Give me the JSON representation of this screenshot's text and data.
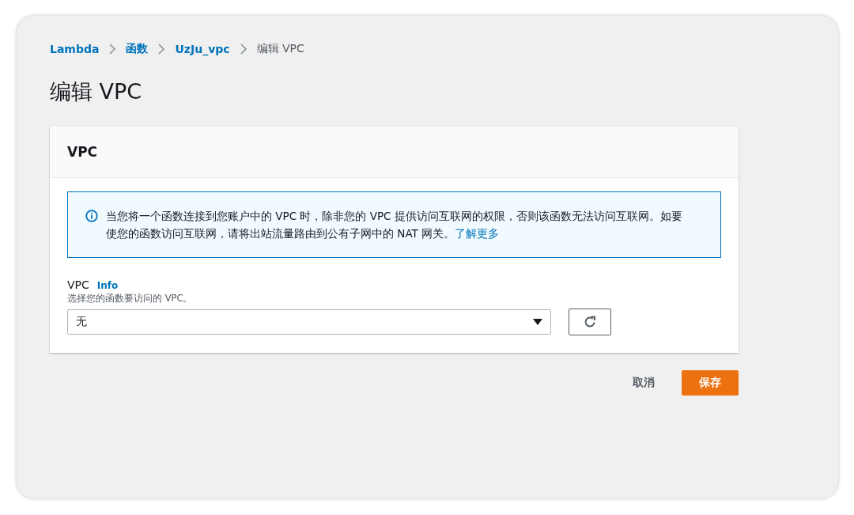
{
  "breadcrumb": [
    {
      "label": "Lambda",
      "link": true
    },
    {
      "label": "函数",
      "link": true
    },
    {
      "label": "UzJu_vpc",
      "link": true
    },
    {
      "label": "编辑 VPC",
      "link": false
    }
  ],
  "page_title": "编辑 VPC",
  "panel": {
    "title": "VPC",
    "alert": {
      "message": "当您将一个函数连接到您账户中的 VPC 时，除非您的 VPC 提供访问互联网的权限，否则该函数无法访问互联网。如要使您的函数访问互联网，请将出站流量路由到公有子网中的 NAT 网关。",
      "link": "了解更多"
    },
    "field": {
      "label": "VPC",
      "info": "Info",
      "description": "选择您的函数要访问的 VPC。",
      "value": "无"
    }
  },
  "buttons": [
    {
      "label": "取消",
      "kind": "secondary"
    },
    {
      "label": "保存",
      "kind": "primary"
    }
  ]
}
